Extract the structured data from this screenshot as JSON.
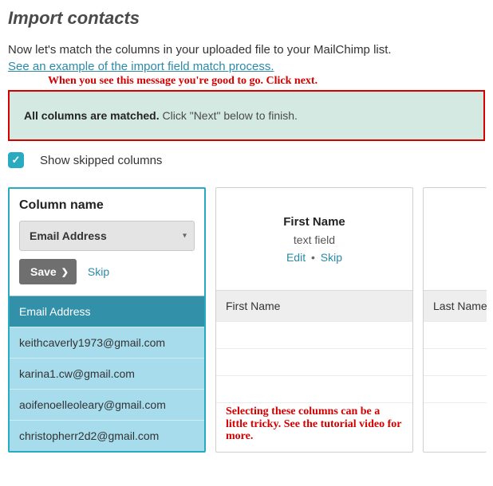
{
  "page": {
    "title": "Import contacts",
    "instruction": "Now let's match the columns in your uploaded file to your MailChimp list.",
    "example_link": "See an example of the import field match process."
  },
  "annotations": {
    "top": "When you see this message you're good to go. Click next.",
    "overlay": "Selecting these columns can be a little tricky. See the tutorial video for more."
  },
  "success": {
    "strong": "All columns are matched.",
    "rest": " Click \"Next\" below to finish."
  },
  "show_skipped": {
    "label": "Show skipped columns",
    "checked": true
  },
  "active_column": {
    "title": "Column name",
    "select_value": "Email Address",
    "save_label": "Save",
    "skip_label": "Skip",
    "header_cell": "Email Address",
    "rows": [
      "keithcaverly1973@gmail.com",
      "karina1.cw@gmail.com",
      "aoifenoelleoleary@gmail.com",
      "christopherr2d2@gmail.com"
    ]
  },
  "second_column": {
    "title": "First Name",
    "type": "text field",
    "edit_label": "Edit",
    "skip_label": "Skip",
    "header_cell": "First Name",
    "rows": [
      "",
      "",
      "",
      ""
    ]
  },
  "third_column": {
    "header_cell": "Last Name"
  }
}
